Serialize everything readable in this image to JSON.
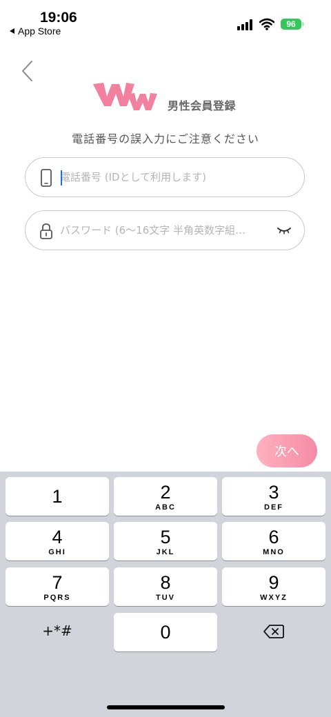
{
  "status_bar": {
    "time": "19:06",
    "back_label": "App Store",
    "battery": "96",
    "battery_color": "#34c759"
  },
  "header": {
    "logo_text": "WW",
    "logo_color": "#f2809f",
    "title": "男性会員登録",
    "back_icon": "chevron-left-icon"
  },
  "notice": "電話番号の誤入力にご注意ください",
  "form": {
    "phone": {
      "icon": "phone-icon",
      "value": "",
      "placeholder": "電話番号 (IDとして利用します)"
    },
    "password": {
      "icon": "lock-icon",
      "value": "",
      "placeholder": "パスワード (6～16文字 半角英数字組…",
      "toggle_icon": "eye-closed-icon"
    }
  },
  "next_button": {
    "label": "次へ",
    "color_start": "#ffb1bf",
    "color_end": "#f58ba6"
  },
  "keypad": {
    "keys": [
      {
        "digit": "1",
        "letters": ""
      },
      {
        "digit": "2",
        "letters": "ABC"
      },
      {
        "digit": "3",
        "letters": "DEF"
      },
      {
        "digit": "4",
        "letters": "GHI"
      },
      {
        "digit": "5",
        "letters": "JKL"
      },
      {
        "digit": "6",
        "letters": "MNO"
      },
      {
        "digit": "7",
        "letters": "PQRS"
      },
      {
        "digit": "8",
        "letters": "TUV"
      },
      {
        "digit": "9",
        "letters": "WXYZ"
      },
      {
        "digit": "0",
        "letters": ""
      }
    ],
    "symbols": "+*#",
    "backspace_icon": "backspace-icon"
  }
}
